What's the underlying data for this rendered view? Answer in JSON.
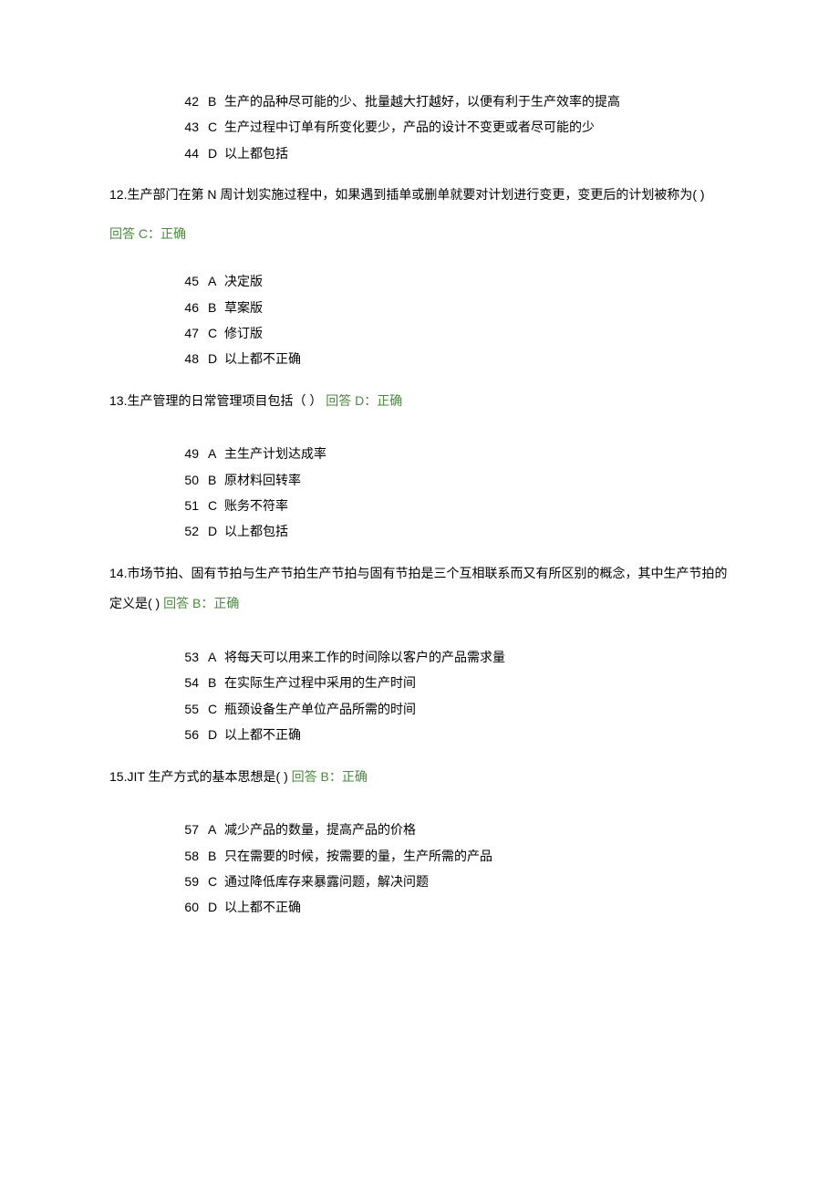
{
  "pre_options": [
    {
      "num": "42",
      "letter": "B",
      "text": "生产的品种尽可能的少、批量越大打越好，以便有利于生产效率的提高"
    },
    {
      "num": "43",
      "letter": "C",
      "text": "生产过程中订单有所变化要少，产品的设计不变更或者尽可能的少"
    },
    {
      "num": "44",
      "letter": "D",
      "text": "以上都包括"
    }
  ],
  "questions": [
    {
      "num": "12.",
      "text": "生产部门在第 N 周计划实施过程中，如果遇到插单或删单就要对计划进行变更，变更后的计划被称为( )",
      "answer_inline": false,
      "answer": "C：正确",
      "answer_prefix": "回答 ",
      "options": [
        {
          "num": "45",
          "letter": "A",
          "text": "决定版"
        },
        {
          "num": "46",
          "letter": "B",
          "text": "草案版"
        },
        {
          "num": "47",
          "letter": "C",
          "text": "修订版"
        },
        {
          "num": "48",
          "letter": "D",
          "text": "以上都不正确"
        }
      ]
    },
    {
      "num": "13.",
      "text": "生产管理的日常管理项目包括（ ） ",
      "answer_inline": true,
      "answer": "D：正确",
      "answer_prefix": "回答 ",
      "options": [
        {
          "num": "49",
          "letter": "A",
          "text": "主生产计划达成率"
        },
        {
          "num": "50",
          "letter": "B",
          "text": "原材料回转率"
        },
        {
          "num": "51",
          "letter": "C",
          "text": "账务不符率"
        },
        {
          "num": "52",
          "letter": "D",
          "text": "以上都包括"
        }
      ]
    },
    {
      "num": "14.",
      "text": "市场节拍、固有节拍与生产节拍生产节拍与固有节拍是三个互相联系而又有所区别的概念，其中生产节拍的定义是( ) ",
      "answer_inline": true,
      "answer": "B：正确",
      "answer_prefix": "回答 ",
      "options": [
        {
          "num": "53",
          "letter": "A",
          "text": "将每天可以用来工作的时间除以客户的产品需求量"
        },
        {
          "num": "54",
          "letter": "B",
          "text": "在实际生产过程中采用的生产时间"
        },
        {
          "num": "55",
          "letter": "C",
          "text": "瓶颈设备生产单位产品所需的时间"
        },
        {
          "num": "56",
          "letter": "D",
          "text": "以上都不正确"
        }
      ]
    },
    {
      "num": "15.",
      "text": "JIT 生产方式的基本思想是( ) ",
      "answer_inline": true,
      "answer": "B：正确",
      "answer_prefix": "回答 ",
      "options": [
        {
          "num": "57",
          "letter": "A",
          "text": "减少产品的数量，提高产品的价格"
        },
        {
          "num": "58",
          "letter": "B",
          "text": "只在需要的时候，按需要的量，生产所需的产品"
        },
        {
          "num": "59",
          "letter": "C",
          "text": "通过降低库存来暴露问题，解决问题"
        },
        {
          "num": "60",
          "letter": "D",
          "text": "以上都不正确"
        }
      ]
    }
  ]
}
